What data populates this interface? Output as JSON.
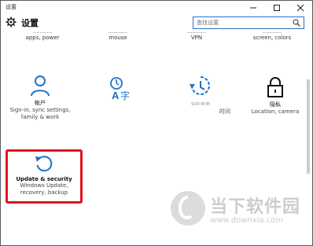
{
  "window": {
    "title": "设置",
    "minimize_icon": "minimize-icon",
    "maximize_icon": "maximize-icon",
    "close_icon": "close-icon"
  },
  "header": {
    "title": "设置",
    "search_placeholder": "查找设置"
  },
  "partial_row": [
    {
      "line1": "...........",
      "line2": "apps, power"
    },
    {
      "line1": "...........",
      "line2": "mouse"
    },
    {
      "line1": "...........",
      "line2": "VPN"
    },
    {
      "line1": "...........",
      "line2": "screen, colors"
    }
  ],
  "tiles": [
    {
      "name": "帐户",
      "desc1": "Sign-in, sync settings,",
      "desc2": "family & work",
      "icon": "person-icon"
    },
    {
      "name": "",
      "desc1": "",
      "desc2": "",
      "icon": "time-language-icon"
    },
    {
      "name": "",
      "desc1": "",
      "desc2": "",
      "icon": "ease-of-access-icon"
    },
    {
      "name": "隐私",
      "desc1": "Location, camera",
      "desc2": "",
      "icon": "lock-icon"
    }
  ],
  "fragments": {
    "tile3_label": "轻松使用",
    "tile3_suffix": "时间"
  },
  "update_tile": {
    "name": "Update & security",
    "desc1": "Windows Update,",
    "desc2": "recovery, backup",
    "icon": "sync-icon"
  },
  "watermark": {
    "text": "当下软件园",
    "url": "www.downxia.com"
  },
  "colors": {
    "accent": "#1e73c8",
    "highlight": "#e0141e"
  }
}
